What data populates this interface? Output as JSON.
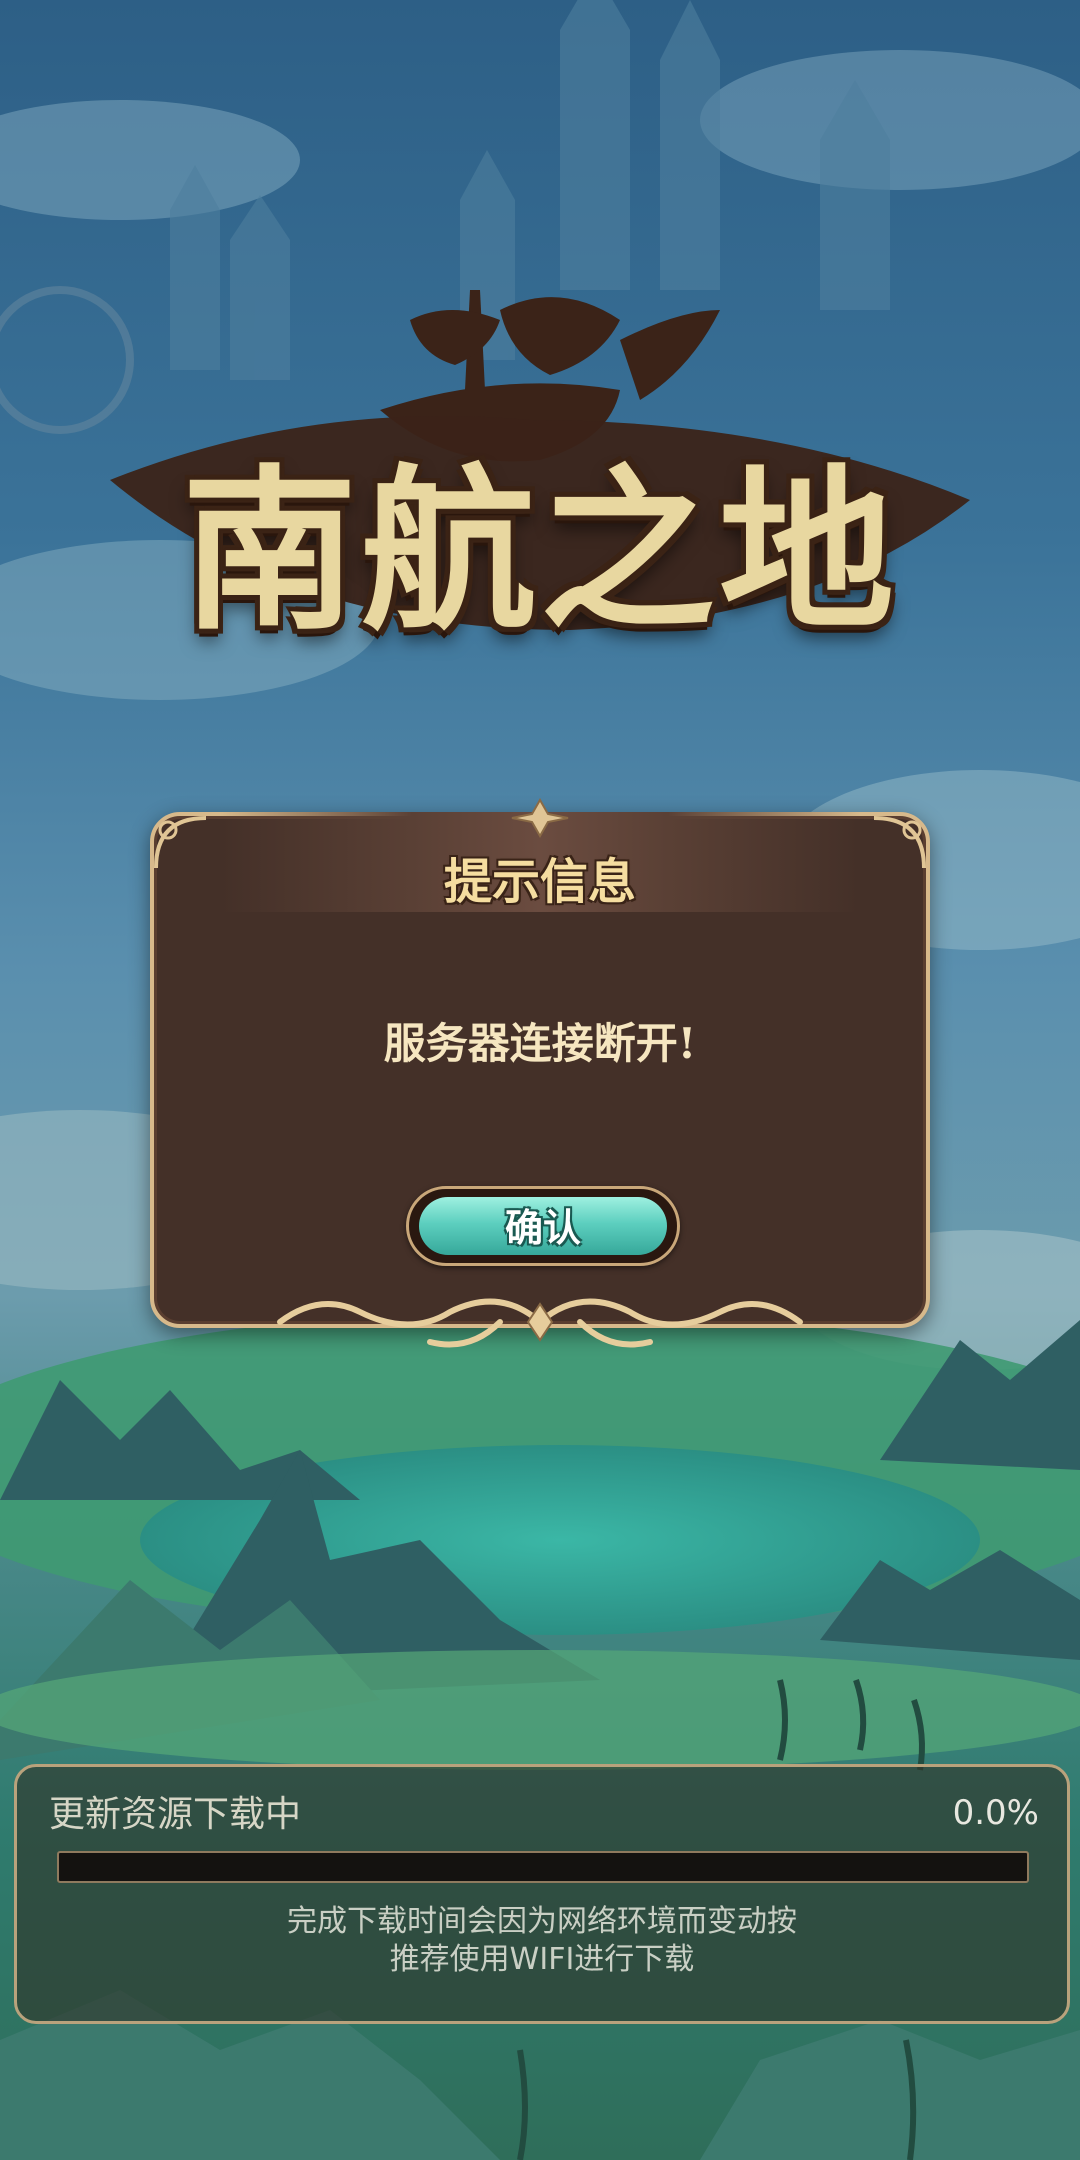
{
  "app": {
    "logo_text": "南航之地"
  },
  "dialog": {
    "title": "提示信息",
    "message": "服务器连接断开!",
    "confirm_label": "确认"
  },
  "download": {
    "title": "更新资源下载中",
    "percent_text": "0.0%",
    "progress": 0.0,
    "note_line1": "完成下载时间会因为网络环境而变动按",
    "note_line2": "推荐使用WIFI进行下载"
  },
  "colors": {
    "dialog_bg": "#443028",
    "dialog_border": "#d7b98b",
    "button_teal": "#5dcfbf",
    "title_gold": "#f5dda0"
  }
}
